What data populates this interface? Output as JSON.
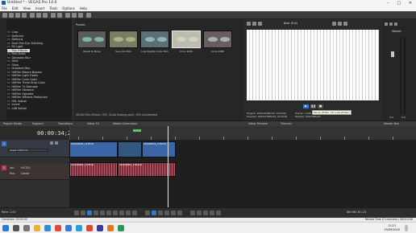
{
  "title": "Untitled * - VEGAS Pro 14.0",
  "menu": [
    "File",
    "Edit",
    "View",
    "Insert",
    "Tools",
    "Options",
    "Help"
  ],
  "fx_list": [
    "Crop",
    "Deflicker",
    "Defocus",
    "Dual Fish Eye Stitching",
    "Fill Light",
    "Film Effects",
    "Film Grain",
    "Gaussian Blur",
    "Glint",
    "Glow",
    "Gradient Map",
    "HitFilm Bleach Bypass",
    "HitFilm Light Flares",
    "HitFilm Color Grain",
    "HitFilm Three Strip Color",
    "HitFilm Tv Damage",
    "HitFilm Vibrance",
    "HitFilm Vignette",
    "HitFilm Witness Protection",
    "HSL Adjust",
    "Invert",
    "LAB Adjust"
  ],
  "fx_tag": "FX",
  "fx_selected_index": 5,
  "presets_label": "Preset:",
  "presets": [
    {
      "name": "Reset to None"
    },
    {
      "name": "Very Old Film"
    },
    {
      "name": "Low Quality Color Film"
    },
    {
      "name": "Circa 1930"
    },
    {
      "name": "Circa 1980"
    }
  ],
  "presets_status": "VEGAS Film Effects: OFX, 32-bit floating point, GPU Accelerated",
  "preview": {
    "quality": "Best (Full)",
    "project_info": "Project: 1920x1080x32, 29.970p",
    "preview_info": "Preview: 1920x1080x32, 29.970p",
    "frame_info": "Frame: 1,026",
    "display_info": "Display: 330x186x32",
    "pause_tip": "Pause (Enter, Ctrl+Alt+Enter)"
  },
  "master": {
    "label": "Master",
    "scale": [
      "0.0",
      "0.0"
    ]
  },
  "tabs": [
    "Project Media",
    "Explorer",
    "Transitions",
    "Video FX",
    "Media Generators",
    "Video Preview",
    "Trimmer",
    "Master Bus"
  ],
  "timeline": {
    "timecode": "00:00:34;23",
    "cursor_time": "00:00:34;23",
    "tracks": [
      {
        "number": "1",
        "level_label": "Level: 100.0 %",
        "clips": [
          "20200908_123510",
          "20200824_135410"
        ],
        "color": "#2f5fa8"
      },
      {
        "number": "2",
        "vol_label": "Vol:",
        "vol_value": "MUTED",
        "pan_label": "Pan:",
        "pan_value": "Center",
        "clips": [
          "20200908_123510",
          "20200824_135410"
        ],
        "color": "#8a2b3c"
      }
    ]
  },
  "transport": {
    "rate": "Rate: 1.00",
    "time": "00:00:34;23"
  },
  "status": {
    "left": "Complete: 00:00:00",
    "right": "Record Time (2 channels): 383:10:00"
  },
  "clock": {
    "time": "12:21",
    "date": "29/09/2020"
  }
}
